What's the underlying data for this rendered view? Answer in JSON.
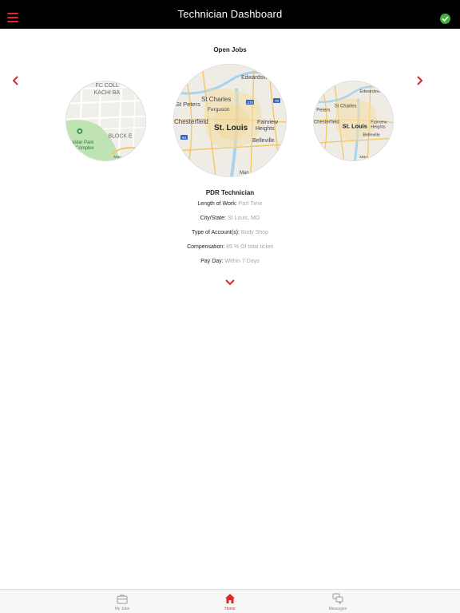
{
  "header": {
    "title": "Technician Dashboard"
  },
  "section": {
    "title": "Open Jobs"
  },
  "maps": {
    "left": {
      "labels": [
        "FC COLL",
        "KACHI BA",
        "BLOCK E",
        "spitar Park",
        "ts Complex",
        "Man"
      ]
    },
    "center": {
      "labels": [
        "Edwardsville",
        "St Peters",
        "St Charles",
        "Ferguson",
        "Chesterfield",
        "St. Louis",
        "Fairview",
        "Heights",
        "Belleville",
        "Man",
        "270",
        "70",
        "64"
      ]
    },
    "right": {
      "labels": [
        "Edwardsville",
        "t Peters",
        "St Charles",
        "Chesterfield",
        "St. Louis",
        "Fairview",
        "Heights",
        "Belleville",
        "Man"
      ]
    }
  },
  "job": {
    "title": "PDR Technician",
    "details": [
      {
        "label": "Length of Work:",
        "value": "Part Time"
      },
      {
        "label": "City/State:",
        "value": "St Louis, MO"
      },
      {
        "label": "Type of Account(s):",
        "value": "Body Shop"
      },
      {
        "label": "Compensation:",
        "value": "85 % Of total ticket"
      },
      {
        "label": "Pay Day:",
        "value": "Within 7 Days"
      }
    ]
  },
  "tabs": [
    {
      "label": "My Jobs",
      "icon": "briefcase-icon",
      "active": false
    },
    {
      "label": "Home",
      "icon": "home-icon",
      "active": true
    },
    {
      "label": "Messages",
      "icon": "chat-icon",
      "active": false
    }
  ],
  "colors": {
    "accent": "#e0252b",
    "header_bg": "#000000",
    "status_green": "#3fb23a",
    "muted_value": "#a7a7a7"
  }
}
